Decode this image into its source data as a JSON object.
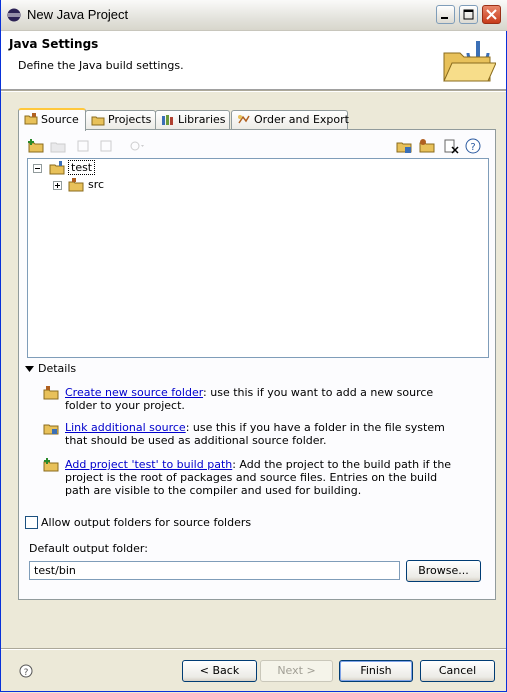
{
  "window": {
    "title": "New Java Project"
  },
  "header": {
    "title": "Java Settings",
    "description": "Define the Java build settings."
  },
  "tabs": [
    {
      "label": "Source",
      "icon": "source-folder-icon",
      "active": true
    },
    {
      "label": "Projects",
      "icon": "projects-icon",
      "active": false
    },
    {
      "label": "Libraries",
      "icon": "libraries-icon",
      "active": false
    },
    {
      "label": "Order and Export",
      "icon": "order-export-icon",
      "active": false
    }
  ],
  "tree": {
    "root": "test",
    "children": [
      {
        "label": "src"
      }
    ]
  },
  "details": {
    "heading": "Details",
    "items": [
      {
        "link": "Create new source folder",
        "text": ": use this if you want to add a new source folder to your project."
      },
      {
        "link": "Link additional source",
        "text": ": use this if you have a folder in the file system that should be used as additional source folder."
      },
      {
        "link": "Add project 'test' to build path",
        "text": ": Add the project to the build path if the project is the root of packages and source files. Entries on the build path are visible to the compiler and used for building."
      }
    ]
  },
  "options": {
    "allow_output_label": "Allow output folders for source folders",
    "default_output_label": "Default output folder:",
    "default_output_value": "test/bin",
    "browse_label": "Browse..."
  },
  "buttons": {
    "back": "< Back",
    "next": "Next >",
    "finish": "Finish",
    "cancel": "Cancel"
  },
  "colors": {
    "link": "#0000cc",
    "tab_highlight": "#ffc83c",
    "background": "#ece9d8"
  }
}
